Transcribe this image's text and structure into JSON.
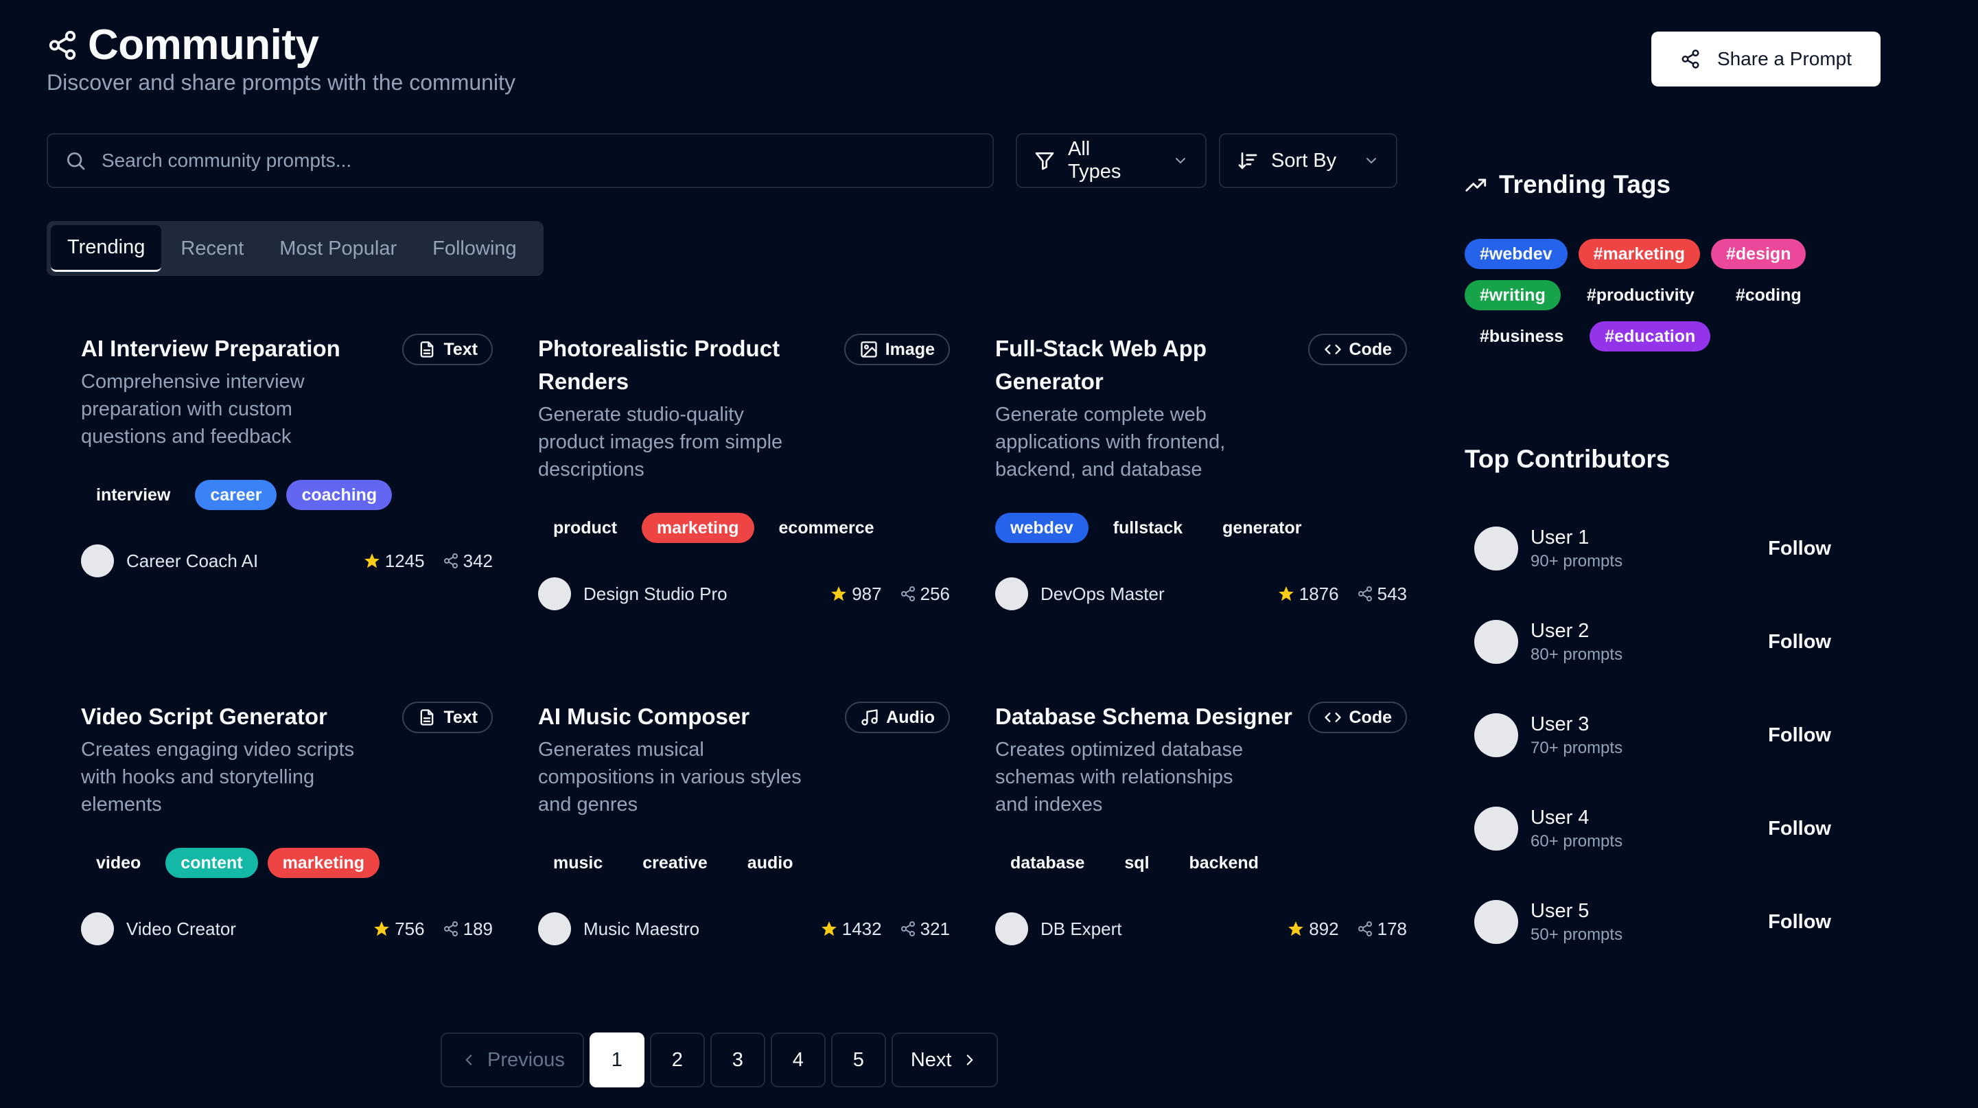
{
  "header": {
    "title": "Community",
    "subtitle": "Discover and share prompts with the community",
    "share_label": "Share a Prompt"
  },
  "search": {
    "placeholder": "Search community prompts..."
  },
  "filters": {
    "types_label": "All Types",
    "sort_label": "Sort By"
  },
  "tabs": [
    "Trending",
    "Recent",
    "Most Popular",
    "Following"
  ],
  "active_tab": "Trending",
  "cards": [
    {
      "title": "AI Interview Preparation",
      "type": "Text",
      "type_icon": "document-icon",
      "description": "Comprehensive interview preparation with custom questions and feedback",
      "tags": [
        {
          "label": "interview",
          "color": ""
        },
        {
          "label": "career",
          "color": "#3b82f6"
        },
        {
          "label": "coaching",
          "color": "#6366f1"
        }
      ],
      "author": "Career Coach AI",
      "stars": "1245",
      "shares": "342"
    },
    {
      "title": "Photorealistic Product Renders",
      "type": "Image",
      "type_icon": "image-icon",
      "description": "Generate studio-quality product images from simple descriptions",
      "tags": [
        {
          "label": "product",
          "color": ""
        },
        {
          "label": "marketing",
          "color": "#ef4444"
        },
        {
          "label": "ecommerce",
          "color": ""
        }
      ],
      "author": "Design Studio Pro",
      "stars": "987",
      "shares": "256"
    },
    {
      "title": "Full-Stack Web App Generator",
      "type": "Code",
      "type_icon": "code-icon",
      "description": "Generate complete web applications with frontend, backend, and database",
      "tags": [
        {
          "label": "webdev",
          "color": "#2563eb"
        },
        {
          "label": "fullstack",
          "color": ""
        },
        {
          "label": "generator",
          "color": ""
        }
      ],
      "author": "DevOps Master",
      "stars": "1876",
      "shares": "543"
    },
    {
      "title": "Video Script Generator",
      "type": "Text",
      "type_icon": "document-icon",
      "description": "Creates engaging video scripts with hooks and storytelling elements",
      "tags": [
        {
          "label": "video",
          "color": ""
        },
        {
          "label": "content",
          "color": "#14b8a6"
        },
        {
          "label": "marketing",
          "color": "#ef4444"
        }
      ],
      "author": "Video Creator",
      "stars": "756",
      "shares": "189"
    },
    {
      "title": "AI Music Composer",
      "type": "Audio",
      "type_icon": "music-note-icon",
      "description": "Generates musical compositions in various styles and genres",
      "tags": [
        {
          "label": "music",
          "color": ""
        },
        {
          "label": "creative",
          "color": ""
        },
        {
          "label": "audio",
          "color": ""
        }
      ],
      "author": "Music Maestro",
      "stars": "1432",
      "shares": "321"
    },
    {
      "title": "Database Schema Designer",
      "type": "Code",
      "type_icon": "code-icon",
      "description": "Creates optimized database schemas with relationships and indexes",
      "tags": [
        {
          "label": "database",
          "color": ""
        },
        {
          "label": "sql",
          "color": ""
        },
        {
          "label": "backend",
          "color": ""
        }
      ],
      "author": "DB Expert",
      "stars": "892",
      "shares": "178"
    }
  ],
  "sidebar": {
    "trending_title": "Trending Tags",
    "trending_tags": [
      {
        "label": "#webdev",
        "color": "#2563eb"
      },
      {
        "label": "#marketing",
        "color": "#ef4444"
      },
      {
        "label": "#design",
        "color": "#ec4899"
      },
      {
        "label": "#writing",
        "color": "#16a34a"
      },
      {
        "label": "#productivity",
        "color": ""
      },
      {
        "label": "#coding",
        "color": ""
      },
      {
        "label": "#business",
        "color": ""
      },
      {
        "label": "#education",
        "color": "#9333ea"
      }
    ],
    "contributors_title": "Top Contributors",
    "contributors": [
      {
        "name": "User 1",
        "prompts": "90+ prompts",
        "action": "Follow"
      },
      {
        "name": "User 2",
        "prompts": "80+ prompts",
        "action": "Follow"
      },
      {
        "name": "User 3",
        "prompts": "70+ prompts",
        "action": "Follow"
      },
      {
        "name": "User 4",
        "prompts": "60+ prompts",
        "action": "Follow"
      },
      {
        "name": "User 5",
        "prompts": "50+ prompts",
        "action": "Follow"
      }
    ]
  },
  "pagination": {
    "previous": "Previous",
    "next": "Next",
    "pages": [
      "1",
      "2",
      "3",
      "4",
      "5"
    ],
    "current": "1"
  }
}
